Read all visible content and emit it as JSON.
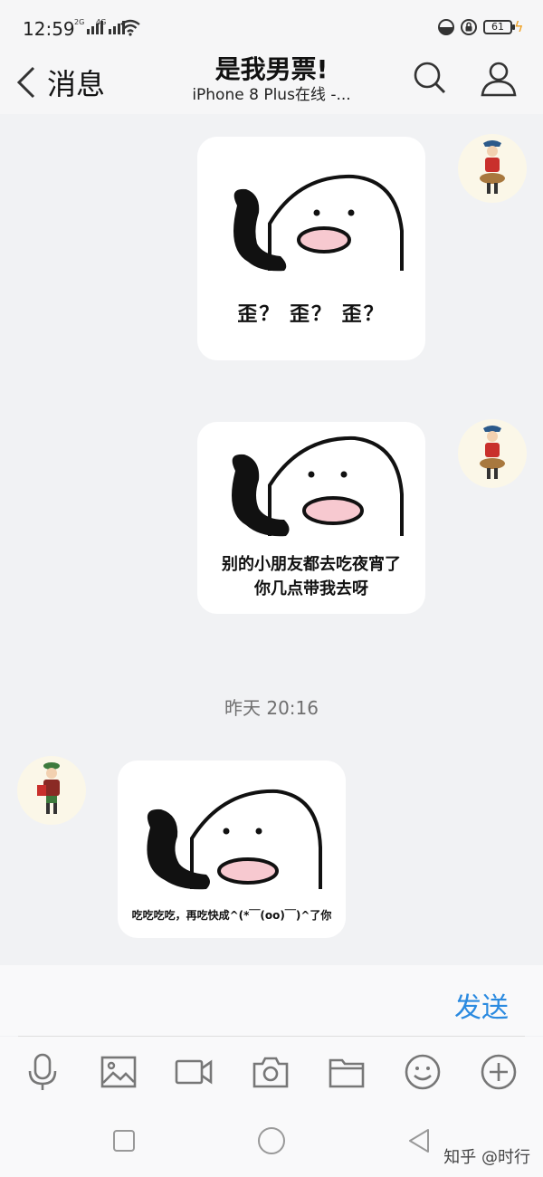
{
  "status_bar": {
    "time": "12:59",
    "signal1_label": "2G",
    "signal2_label": "4G",
    "battery": "61"
  },
  "header": {
    "back_label": "消息",
    "title": "是我男票!",
    "subtitle": "iPhone 8 Plus在线 -..."
  },
  "messages": [
    {
      "sender": "me",
      "type": "sticker",
      "caption": "歪？ 歪？ 歪？"
    },
    {
      "sender": "me",
      "type": "sticker",
      "caption_line1": "别的小朋友都去吃夜宵了",
      "caption_line2": "你几点带我去呀"
    },
    {
      "sender": "them",
      "type": "sticker",
      "caption": "吃吃吃吃，再吃快成^(*￣(oo)￣)^了你"
    }
  ],
  "timestamp": "昨天 20:16",
  "input": {
    "send_label": "发送"
  },
  "toolbar_icons": [
    "microphone-icon",
    "image-icon",
    "video-icon",
    "camera-icon",
    "folder-icon",
    "emoji-icon",
    "plus-icon"
  ],
  "watermark": "知乎 @时行",
  "colors": {
    "accent": "#2a8ae0",
    "background": "#f1f2f4",
    "bubble": "#ffffff",
    "cheek": "#f7c9d0"
  }
}
